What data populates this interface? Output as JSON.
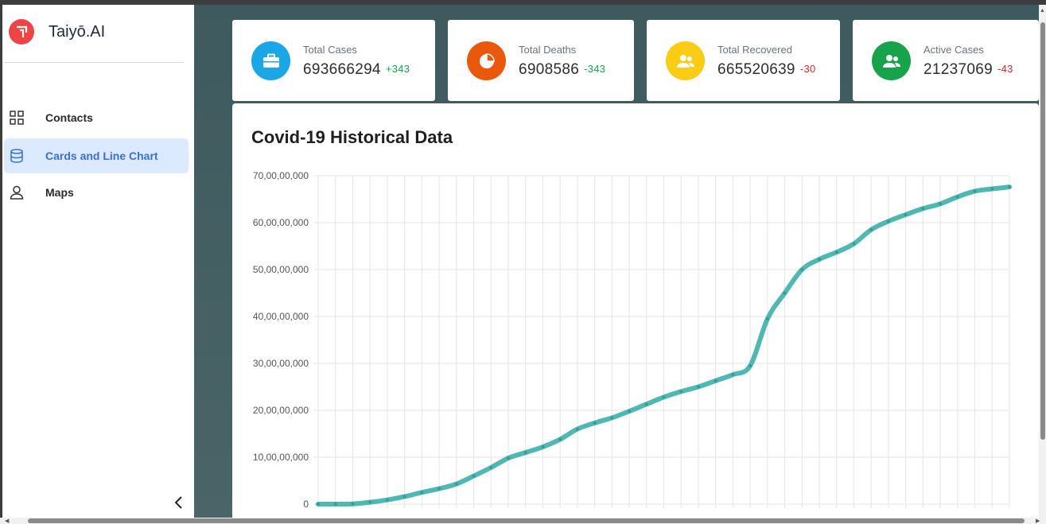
{
  "app": {
    "brand_name": "Taiyō.AI"
  },
  "sidebar": {
    "items": [
      {
        "label": "Contacts",
        "icon": "grid-icon"
      },
      {
        "label": "Cards and Line Chart",
        "icon": "database-icon",
        "active": true
      },
      {
        "label": "Maps",
        "icon": "user-icon"
      }
    ],
    "collapse_icon": "chevron-left-icon"
  },
  "cards": [
    {
      "title": "Total Cases",
      "value": "693666294",
      "delta": "+343",
      "color": "#1ba6e6",
      "delta_color": "#16a34a",
      "icon": "briefcase-icon"
    },
    {
      "title": "Total Deaths",
      "value": "6908586",
      "delta": "-343",
      "color": "#ea580c",
      "delta_color": "#16a34a",
      "icon": "pie-chart-icon"
    },
    {
      "title": "Total Recovered",
      "value": "665520639",
      "delta": "-30",
      "color": "#facc15",
      "delta_color": "#dc2626",
      "icon": "users-icon"
    },
    {
      "title": "Active Cases",
      "value": "21237069",
      "delta": "-43",
      "color": "#16a34a",
      "delta_color": "#dc2626",
      "icon": "users-icon"
    }
  ],
  "chart_data": {
    "type": "line",
    "title": "Covid-19 Historical Data",
    "xlabel": "",
    "ylabel": "",
    "ylim": [
      0,
      700000000
    ],
    "y_ticks": [
      "0",
      "10,00,00,000",
      "20,00,00,000",
      "30,00,00,000",
      "40,00,00,000",
      "50,00,00,000",
      "60,00,00,000",
      "70,00,00,000"
    ],
    "grid": true,
    "line_color": "#4fb8b2",
    "series": [
      {
        "values": [
          0,
          0,
          500000,
          4000000,
          9000000,
          16000000,
          25000000,
          33000000,
          43000000,
          60000000,
          78000000,
          98000000,
          110000000,
          122000000,
          138000000,
          160000000,
          173000000,
          184000000,
          198000000,
          213000000,
          228000000,
          240000000,
          250000000,
          263000000,
          276000000,
          295000000,
          395000000,
          450000000,
          500000000,
          522000000,
          537000000,
          555000000,
          585000000,
          603000000,
          617000000,
          630000000,
          640000000,
          655000000,
          667000000,
          672000000,
          676000000
        ]
      }
    ]
  }
}
